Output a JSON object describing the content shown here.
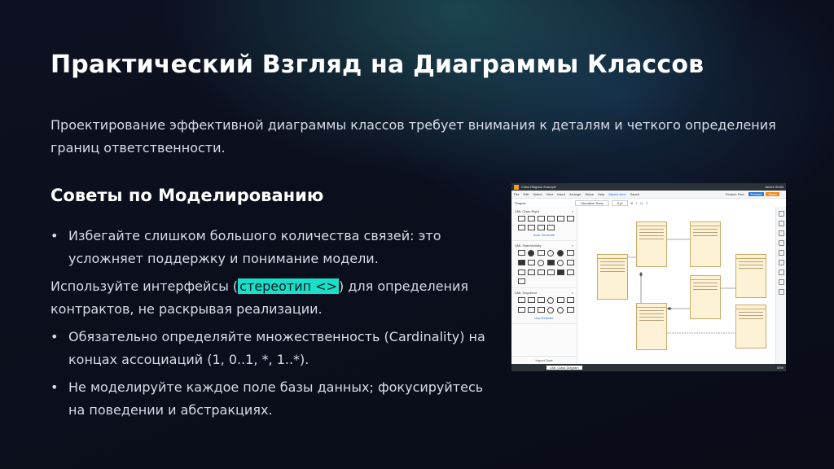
{
  "slide": {
    "title": "Практический Взгляд на Диаграммы Классов",
    "intro": "Проектирование эффективной диаграммы классов требует внимания к деталям и четкого определения границ ответственности.",
    "section_heading": "Советы по Моделированию",
    "bullet_char": "•",
    "tip1": "Избегайте слишком большого количества связей: это усложняет поддержку и понимание модели.",
    "tip2": {
      "before": "Используйте интерфейсы (",
      "highlight": "стереотип <>",
      "after": ") для определения контрактов, не раскрывая реализации."
    },
    "tip3": "Обязательно определяйте множественность (Cardinality) на концах ассоциаций (1, 0..1, *, 1..*).",
    "tip4": "Не моделируйте каждое поле базы данных; фокусируйтесь на поведении и абстракциях.",
    "accent_color": "#18e0c8"
  },
  "screenshot": {
    "window_title": "Class Diagram Example",
    "user": "James Smith",
    "menu": [
      "File",
      "Edit",
      "Select",
      "View",
      "Insert",
      "Arrange",
      "Share",
      "Help"
    ],
    "whats_new": "What's New",
    "saved": "Saved",
    "feature_find": "Feature Find",
    "present": "Present",
    "share": "Share",
    "shapes_tab": "Shapes",
    "font": "Liberation Sans",
    "font_size": "8 pt",
    "libraries": [
      "UML Class Right",
      "UML State/Activity",
      "UML Sequence"
    ],
    "more_shapes": "Auto Generate",
    "use_refactor": "Use Refactor",
    "import_data": "Import Data",
    "page_tab": "UML Class Diagram",
    "zoom": "50%"
  }
}
